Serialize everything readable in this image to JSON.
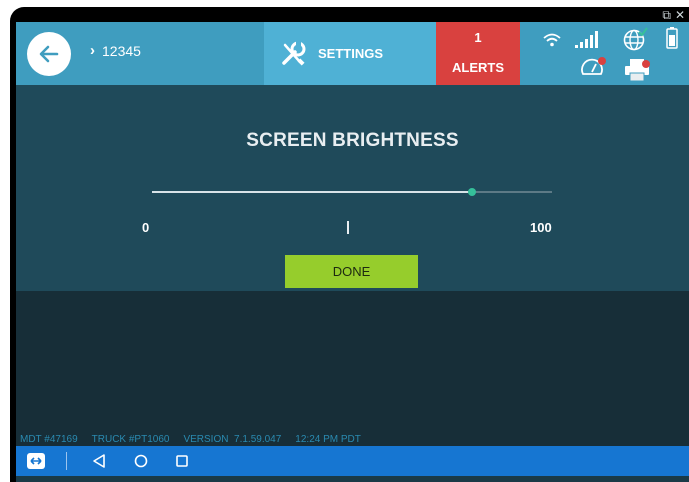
{
  "header": {
    "breadcrumb": "12345",
    "settings_label": "SETTINGS",
    "alerts_count": "1",
    "alerts_label": "ALERTS"
  },
  "status_icons": [
    "wifi-icon",
    "signal-bars-icon",
    "globe-icon",
    "battery-icon",
    "gauge-icon",
    "printer-icon"
  ],
  "brightness": {
    "title": "SCREEN BRIGHTNESS",
    "min_label": "0",
    "max_label": "100",
    "value_percent": 80,
    "done_label": "DONE"
  },
  "footer": {
    "mdt": "MDT #47169",
    "truck": "TRUCK #PT1060",
    "version": "VERSION  7.1.59.047",
    "time": "12:24 PM PDT"
  },
  "colors": {
    "header": "#3f9dbf",
    "settings_tab": "#4fb1d5",
    "alerts": "#d9413f",
    "panel": "#1f4a5a",
    "done_button": "#96cd2c",
    "slider_thumb": "#35c09a",
    "navbar": "#1676d2"
  }
}
